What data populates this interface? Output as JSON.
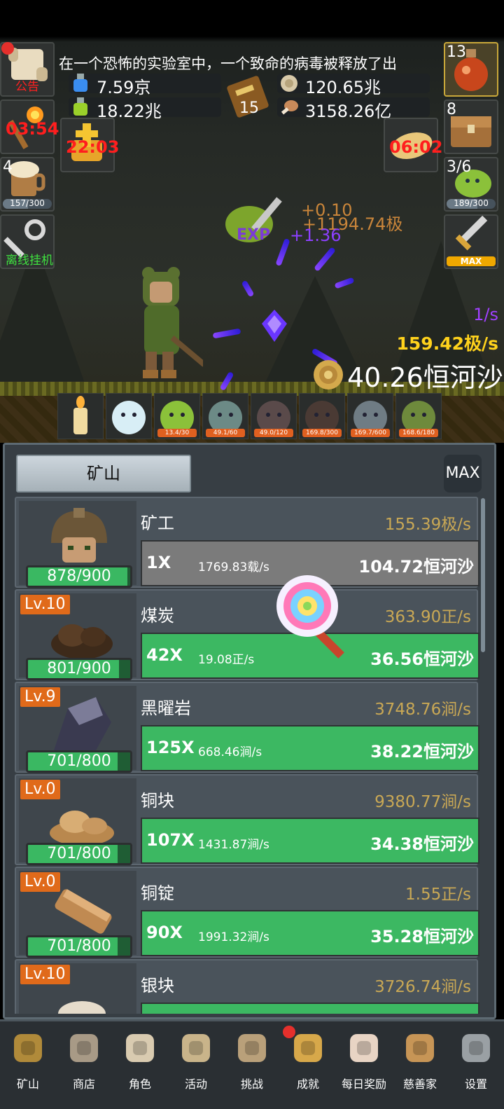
{
  "announcement": "在一个恐怖的实验室中，一个致命的病毒被释放了出",
  "left_buttons": {
    "notice_label": "公告",
    "torch_timer": "03:54",
    "mug_count": "4",
    "mug_progress": "157/300",
    "mug_fraction": 0.52,
    "offline_label": "离线挂机"
  },
  "resources": {
    "blue_potion": "7.59京",
    "green_potion": "18.22兆",
    "book_count": "15",
    "coin": "120.65兆",
    "meat": "3158.26亿"
  },
  "timers": {
    "sun_timer": "22:03",
    "cookie_timer": "06:02"
  },
  "right_buttons": {
    "potion_count": "13",
    "chest_count": "8",
    "slime_count": "3/6",
    "slime_progress": "189/300",
    "slime_fraction": 0.63,
    "sword_label": "MAX"
  },
  "battle": {
    "float_1": "+0.10",
    "float_2": "+1194.74极",
    "float_3": "+1.36",
    "rate_per_sec": "1/s",
    "gold_rate": "159.42极/s",
    "gold_total": "40.26恒河沙"
  },
  "slots": [
    {
      "icon": "candle-icon",
      "bar": ""
    },
    {
      "icon": "egg-icon",
      "bar": ""
    },
    {
      "icon": "slime-icon",
      "bar": "13.4/30"
    },
    {
      "icon": "zombie-icon",
      "bar": "49.1/60"
    },
    {
      "icon": "bat-icon",
      "bar": "49.0/120"
    },
    {
      "icon": "spider-icon",
      "bar": "169.8/300"
    },
    {
      "icon": "golem-icon",
      "bar": "169.7/600"
    },
    {
      "icon": "goblin-icon",
      "bar": "168.6/180"
    }
  ],
  "mine": {
    "tab_label": "矿山",
    "max_label": "MAX",
    "rows": [
      {
        "level": "",
        "name": "矿工",
        "rate": "155.39极/s",
        "hp": "878/900",
        "hp_fraction": 0.976,
        "mult": "1X",
        "cost": "1769.83载/s",
        "value": "104.72恒河沙",
        "style": "grey"
      },
      {
        "level": "Lv.10",
        "name": "煤炭",
        "rate": "363.90正/s",
        "hp": "801/900",
        "hp_fraction": 0.89,
        "mult": "42X",
        "cost": "19.08正/s",
        "value": "36.56恒河沙",
        "style": "green"
      },
      {
        "level": "Lv.9",
        "name": "黑曜岩",
        "rate": "3748.76涧/s",
        "hp": "701/800",
        "hp_fraction": 0.876,
        "mult": "125X",
        "cost": "668.46涧/s",
        "value": "38.22恒河沙",
        "style": "green"
      },
      {
        "level": "Lv.0",
        "name": "铜块",
        "rate": "9380.77涧/s",
        "hp": "701/800",
        "hp_fraction": 0.876,
        "mult": "107X",
        "cost": "1431.87涧/s",
        "value": "34.38恒河沙",
        "style": "green"
      },
      {
        "level": "Lv.0",
        "name": "铜锭",
        "rate": "1.55正/s",
        "hp": "701/800",
        "hp_fraction": 0.876,
        "mult": "90X",
        "cost": "1991.32涧/s",
        "value": "35.28恒河沙",
        "style": "green"
      },
      {
        "level": "Lv.10",
        "name": "银块",
        "rate": "3726.74涧/s",
        "hp": "",
        "hp_fraction": 0,
        "mult": "",
        "cost": "",
        "value": "",
        "style": "green"
      }
    ]
  },
  "nav": [
    {
      "icon": "lantern-icon",
      "label": "矿山"
    },
    {
      "icon": "shop-stone-icon",
      "label": "商店"
    },
    {
      "icon": "skull-icon",
      "label": "角色"
    },
    {
      "icon": "scroll-icon",
      "label": "活动"
    },
    {
      "icon": "map-icon",
      "label": "挑战"
    },
    {
      "icon": "key-icon",
      "label": "成就"
    },
    {
      "icon": "envelope-icon",
      "label": "每日奖励"
    },
    {
      "icon": "bread-icon",
      "label": "慈善家"
    },
    {
      "icon": "gear-icon",
      "label": "设置"
    }
  ]
}
